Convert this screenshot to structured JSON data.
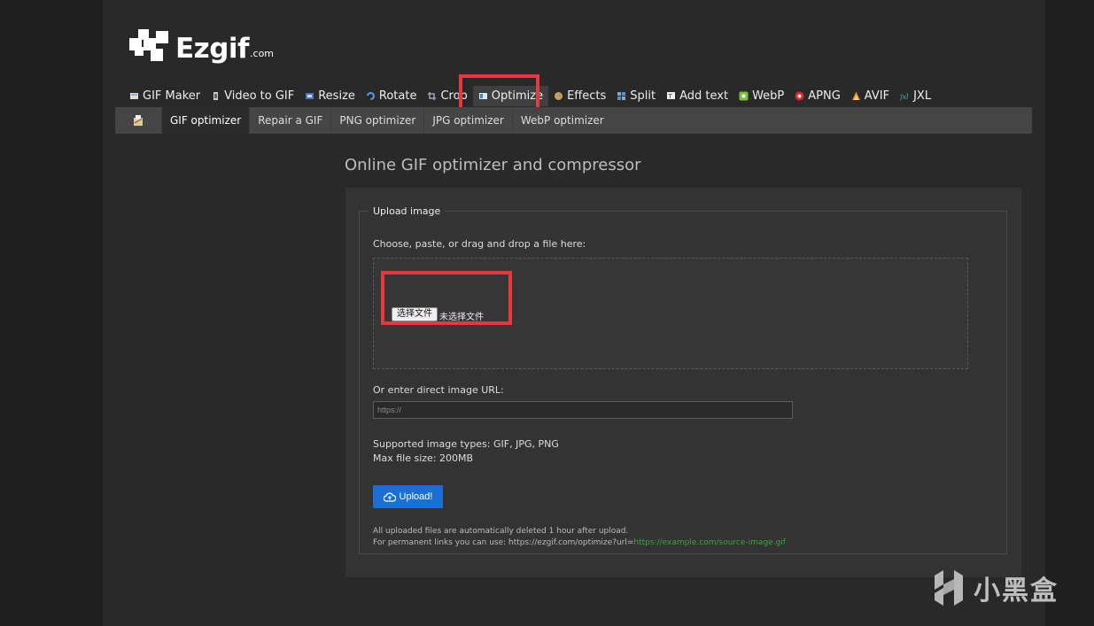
{
  "logo": {
    "name": "Ezgif",
    "suffix": ".com"
  },
  "main_nav": [
    {
      "label": "GIF Maker",
      "icon": "gif-maker-icon"
    },
    {
      "label": "Video to GIF",
      "icon": "video-icon"
    },
    {
      "label": "Resize",
      "icon": "resize-icon"
    },
    {
      "label": "Rotate",
      "icon": "rotate-icon"
    },
    {
      "label": "Crop",
      "icon": "crop-icon"
    },
    {
      "label": "Optimize",
      "icon": "optimize-icon",
      "active": true
    },
    {
      "label": "Effects",
      "icon": "effects-icon"
    },
    {
      "label": "Split",
      "icon": "split-icon"
    },
    {
      "label": "Add text",
      "icon": "add-text-icon"
    },
    {
      "label": "WebP",
      "icon": "webp-icon"
    },
    {
      "label": "APNG",
      "icon": "apng-icon"
    },
    {
      "label": "AVIF",
      "icon": "avif-icon"
    },
    {
      "label": "JXL",
      "icon": "jxl-icon"
    }
  ],
  "sub_nav": [
    {
      "label": "GIF optimizer",
      "active": true
    },
    {
      "label": "Repair a GIF"
    },
    {
      "label": "PNG optimizer"
    },
    {
      "label": "JPG optimizer"
    },
    {
      "label": "WebP optimizer"
    }
  ],
  "page_title": "Online GIF optimizer and compressor",
  "upload": {
    "legend": "Upload image",
    "choose_label": "Choose, paste, or drag and drop a file here:",
    "file_button": "选择文件",
    "file_status": "未选择文件",
    "url_label": "Or enter direct image URL:",
    "url_placeholder": "https://",
    "types": "Supported image types: GIF, JPG, PNG",
    "max_size": "Max file size: 200MB",
    "button": "Upload!",
    "note1": "All uploaded files are automatically deleted 1 hour after upload.",
    "note2_prefix": "For permanent links you can use: https://ezgif.com/optimize?url=",
    "note2_link": "https://example.com/source-image.gif"
  },
  "watermark": "小黑盒",
  "colors": {
    "highlight": "#e8383f",
    "button": "#1b6fd3",
    "link": "#3fa63f"
  }
}
